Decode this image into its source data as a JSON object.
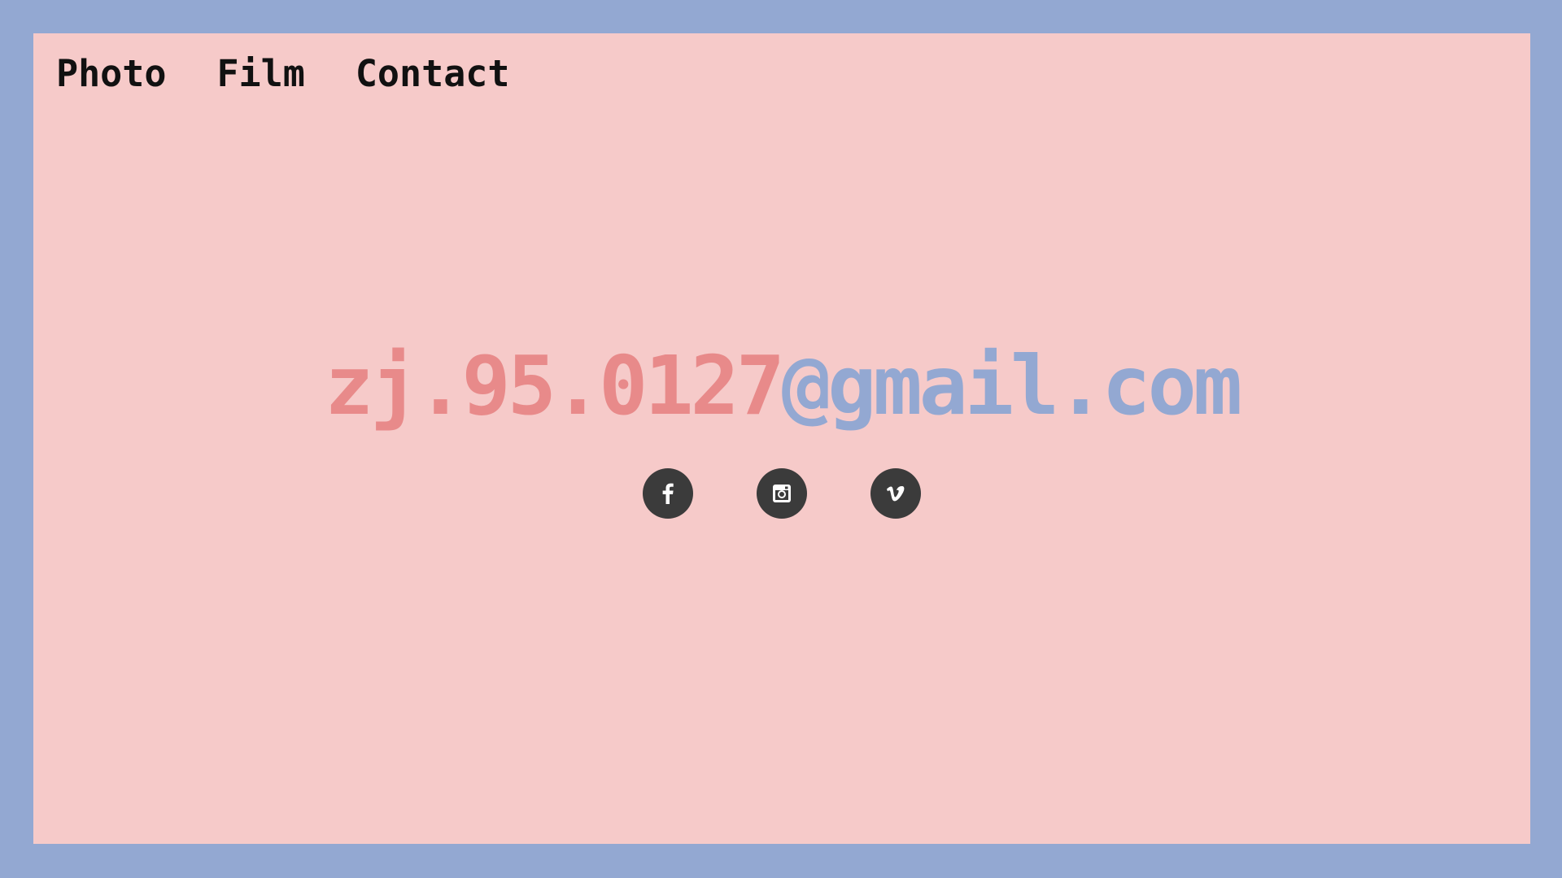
{
  "nav": {
    "items": [
      {
        "label": "Photo"
      },
      {
        "label": "Film"
      },
      {
        "label": "Contact"
      }
    ]
  },
  "contact": {
    "email_user": "zj.95.0127",
    "email_domain": "@gmail.com"
  },
  "socials": [
    {
      "icon": "facebook-icon"
    },
    {
      "icon": "instagram-icon"
    },
    {
      "icon": "vimeo-icon"
    }
  ],
  "colors": {
    "border": "#93a8d2",
    "background": "#f6cac9",
    "email_user": "#e88a8a",
    "email_domain": "#93a8d2",
    "icon_circle": "#3b3b3b",
    "nav_text": "#111111"
  }
}
